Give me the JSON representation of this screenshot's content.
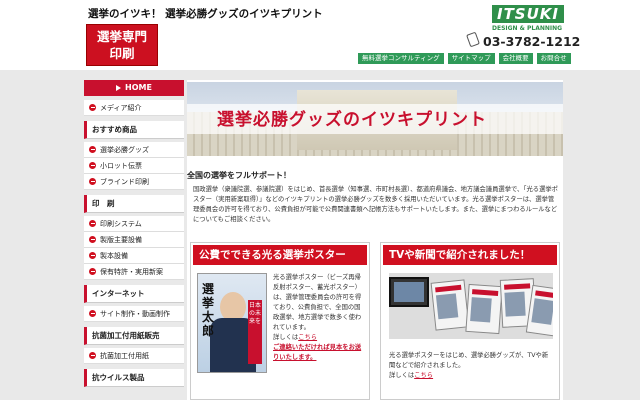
{
  "header": {
    "tagline": "選挙のイツキ！ 選挙必勝グッズのイツキプリント",
    "logo_line1": "選挙専門",
    "logo_line2": "印刷",
    "brand": "ITSUKI",
    "brand_sub": "DESIGN & PLANNING",
    "phone": "03-3782-1212",
    "nav": [
      "無料選挙コンサルティング",
      "サイトマップ",
      "会社概要",
      "お問合せ"
    ]
  },
  "sidebar": {
    "home": "HOME",
    "top_items": [
      "メディア紹介"
    ],
    "sections": [
      {
        "title": "おすすめ商品",
        "items": [
          "選挙必勝グッズ",
          "小ロット伝票",
          "ブラインド印刷"
        ]
      },
      {
        "title": "印　刷",
        "items": [
          "印刷システム",
          "製版主要設備",
          "製本設備",
          "保有特許・実用新案"
        ]
      },
      {
        "title": "インターネット",
        "items": [
          "サイト制作・動画制作"
        ]
      },
      {
        "title": "抗菌加工付用紙販売",
        "items": [
          "抗菌加工付用紙"
        ]
      },
      {
        "title": "抗ウイルス製品",
        "items": []
      }
    ]
  },
  "main": {
    "hero_title": "選挙必勝グッズのイツキプリント",
    "intro_heading": "全国の選挙をフルサポート！",
    "intro_text": "国政選挙（衆議院選、参議院選）をはじめ、首長選挙（知事選、市町村長選）、都道府県議会、地方議会議員選挙で、「光る選挙ポスター（実用新案取得）」などのイツキプリントの選挙必勝グッズを数多く採用いただいています。光る選挙ポスターは、選挙管理委員会の許可を得ており、公費負担が可能で公費関連書類へ記帳方法もサポートいたします。また、選挙にまつわるルールなどについてもご相談ください。",
    "card1": {
      "title": "公費でできる光る選挙ポスター",
      "poster_name": "選挙太郎",
      "poster_sash": "日本の未来を",
      "text": "光る選挙ポスター（ビーズ再帰反射ポスター、蓄光ポスター）は、選挙管理委員会の許可を得ており、公費負担で、全国の国政選挙、地方選挙で数多く使われています。",
      "more_prefix": "詳しくは",
      "more_link": "こちら",
      "note": "ご連絡いただければ見本をお送りいたします。"
    },
    "card2": {
      "title": "TVや新聞で紹介されました！",
      "text": "光る選挙ポスターをはじめ、選挙必勝グッズが、TVや新聞などで紹介されました。",
      "more_prefix": "詳しくは",
      "more_link": "こちら"
    }
  }
}
